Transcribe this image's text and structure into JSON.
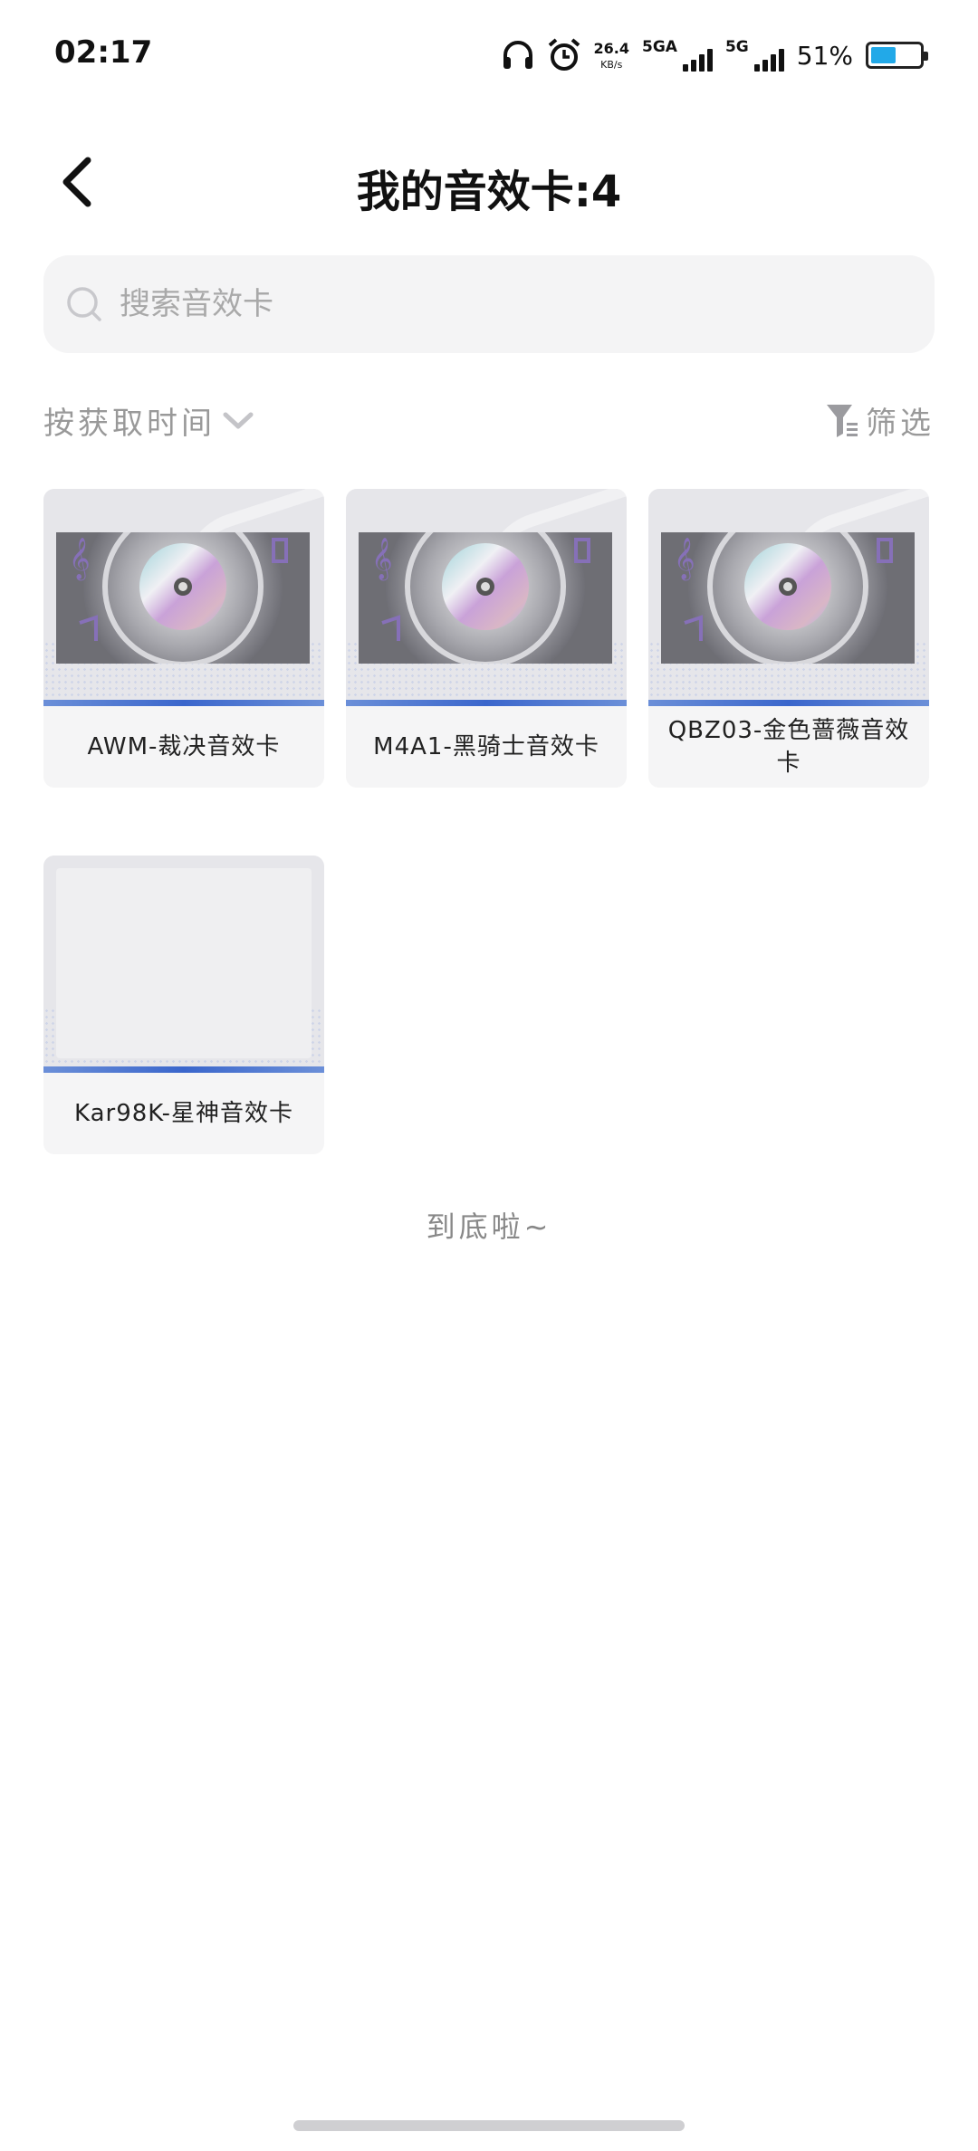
{
  "status": {
    "time": "02:17",
    "net_speed_value": "26.4",
    "net_speed_unit": "KB/s",
    "sim1": "5GA",
    "sim2": "5G",
    "battery_pct": "51%",
    "battery_level": 0.51,
    "icons": [
      "headphones-icon",
      "alarm-icon"
    ]
  },
  "header": {
    "title": "我的音效卡:4"
  },
  "search": {
    "placeholder": "搜索音效卡"
  },
  "toolbar": {
    "sort_label": "按获取时间",
    "filter_label": "筛选"
  },
  "cards": [
    {
      "label": "AWM-裁决音效卡"
    },
    {
      "label": "M4A1-黑骑士音效卡"
    },
    {
      "label": "QBZ03-金色蔷薇音效卡"
    },
    {
      "label": "Kar98K-星神音效卡"
    }
  ],
  "footer": {
    "end_text": "到底啦~"
  },
  "colors": {
    "accent_stripe": "#3a66cc",
    "battery": "#22a9e8",
    "muted_text": "#999999"
  }
}
